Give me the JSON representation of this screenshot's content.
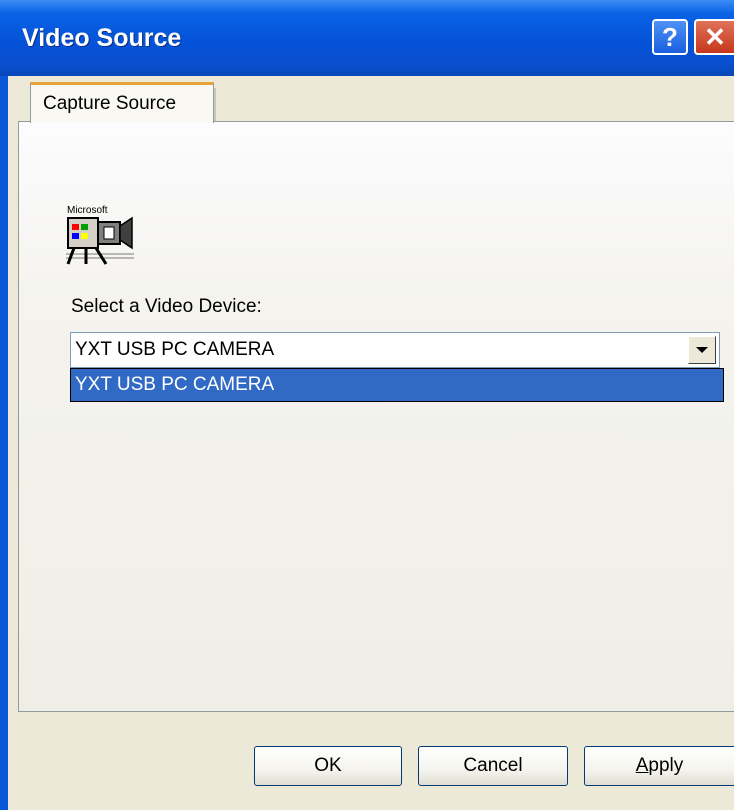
{
  "window": {
    "title": "Video Source",
    "help_glyph": "?",
    "close_glyph": "✕"
  },
  "tabs": [
    {
      "label": "Capture Source",
      "selected": true
    }
  ],
  "capture_source": {
    "logo_text": "Microsoft",
    "device_label": "Select a Video Device:",
    "device_select": {
      "value": "YXT USB PC CAMERA",
      "options": [
        "YXT USB PC CAMERA"
      ],
      "highlighted_option": "YXT USB PC CAMERA"
    }
  },
  "buttons": {
    "ok": "OK",
    "cancel": "Cancel",
    "apply_mnemonic": "A",
    "apply_rest": "pply"
  },
  "colors": {
    "titlebar": "#0a56d8",
    "dialog_face": "#ece9d8",
    "selection": "#316ac5",
    "tab_accent": "#e7a33c"
  },
  "icons": {
    "logo": "video-camera-icon",
    "dropdown": "chevron-down-icon"
  }
}
